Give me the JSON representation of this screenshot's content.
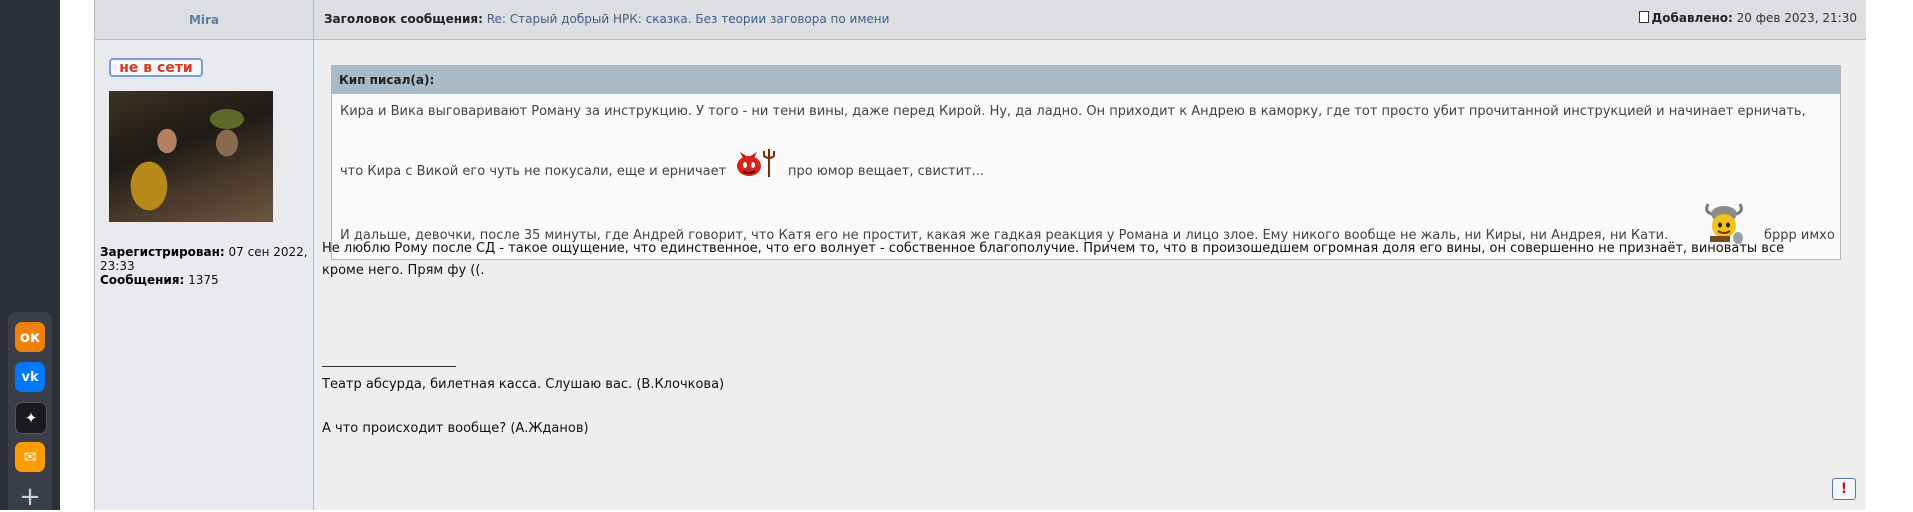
{
  "browser_sidebar": {
    "apps": [
      {
        "name": "odnoklassniki",
        "glyph": "ок",
        "color": "#ee8208"
      },
      {
        "name": "vkontakte",
        "glyph": "vk",
        "color": "#0077ff"
      },
      {
        "name": "zen",
        "glyph": "✦",
        "color": "#1b1b1f"
      },
      {
        "name": "mail",
        "glyph": "✉",
        "color": "#ff9c00"
      },
      {
        "name": "add",
        "glyph": "+"
      }
    ]
  },
  "post": {
    "author": "Mira",
    "title_label": "Заголовок сообщения:",
    "title_link": "Re: Старый добрый НРК: сказка. Без теории заговора по имени",
    "date_label": "Добавлено:",
    "date_value": "20 фев 2023, 21:30",
    "status": "не в сети",
    "registered_label": "Зарегистрирован:",
    "registered_value": "07 сен 2022, 23:33",
    "posts_label": "Сообщения:",
    "posts_value": "1375",
    "quote": {
      "header": "Кип писал(а):",
      "line1": "Кира и Вика выговаривают Роману за инструкцию. У того - ни тени вины, даже перед Кирой. Ну, да ладно. Он приходит к Андрею в каморку, где тот просто убит прочитанной инструкцией и начинает ерничать,",
      "line2a": "что Кира с Викой его чуть не покусали, еще и ерничает",
      "line2b": "про юмор вещает, свистит...",
      "line3a": "И дальше, девочки, после 35 минуты, где Андрей говорит, что Катя его не простит, какая же гадкая реакция у Романа и лицо злое. Ему никого вообще не жаль, ни Киры, ни Андрея, ни Кати.",
      "line3b": "бррр имхо"
    },
    "body_lines": [
      "Не люблю Рому после СД - такое ощущение, что единственное, что его волнует - собственное благополучие. Причем то, что в произошедшем огромная доля его вины, он совершенно не признаёт, виноваты все",
      "кроме него. Прям фу ((."
    ],
    "signature_line1": "Театр абсурда, билетная касса. Слушаю вас. (В.Клочкова)",
    "signature_line2": "А что происходит вообще? (А.Жданов)",
    "report_glyph": "!"
  }
}
